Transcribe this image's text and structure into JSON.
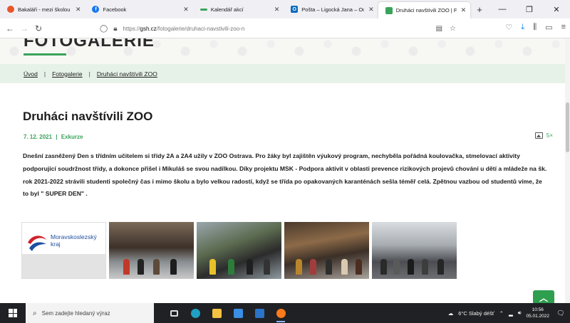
{
  "browser": {
    "tabs": [
      {
        "title": "Bakaláři - mezi školou a rodinou",
        "favicon_color": "#e8562a",
        "active": false
      },
      {
        "title": "Facebook",
        "favicon_color": "#1877f2",
        "active": false
      },
      {
        "title": "Kalendář akcí",
        "favicon_color": "#3aa35a",
        "active": false
      },
      {
        "title": "Pošta – Ligocká Jana – Outlook",
        "favicon_color": "#0f6cbd",
        "active": false
      },
      {
        "title": "Druháci navštívili ZOO | Fotoga",
        "favicon_color": "#3aa35a",
        "active": true
      }
    ],
    "url_prefix": "https://",
    "url_host": "gsh.cz",
    "url_path": "/fotogalerie/druhaci-navstivili-zoo-n"
  },
  "page": {
    "hero_title": "FOTOGALERIE",
    "breadcrumb": [
      "Úvod",
      "Fotogalerie",
      "Druháci navštívili ZOO"
    ],
    "breadcrumb_sep": "|",
    "article_title": "Druháci navštívili ZOO",
    "date": "7. 12. 2021",
    "meta_sep": "|",
    "category": "Exkurze",
    "photo_count": "5×",
    "body": "Dnešní zasněžený Den s třídním učitelem si třídy 2A a 2A4 užily v ZOO Ostrava. Pro žáky byl zajištěn výukový program, nechyběla pořádná koulovačka, stmelovací aktivity podporující soudržnost třídy, a dokonce přišel i Mikuláš se svou nadílkou. Díky projektu MSK - Podpora aktivit v oblasti prevence rizikových projevů chování u dětí a mládeže na šk. rok 2021-2022 strávili studenti společný čas i mimo školu a bylo velkou radostí, když se třída po opakovaných karanténách sešla téměř celá. Zpětnou vazbou od studentů víme, že to byl \" SUPER DEN\" .",
    "logo_line1": "Moravskoslezský",
    "logo_line2": "kraj",
    "accent_color": "#3aa35a"
  },
  "taskbar": {
    "search_placeholder": "Sem zadejte hledaný výraz",
    "weather": "6°C  Slabý déšť",
    "time": "10:56",
    "date": "05.01.2022"
  }
}
